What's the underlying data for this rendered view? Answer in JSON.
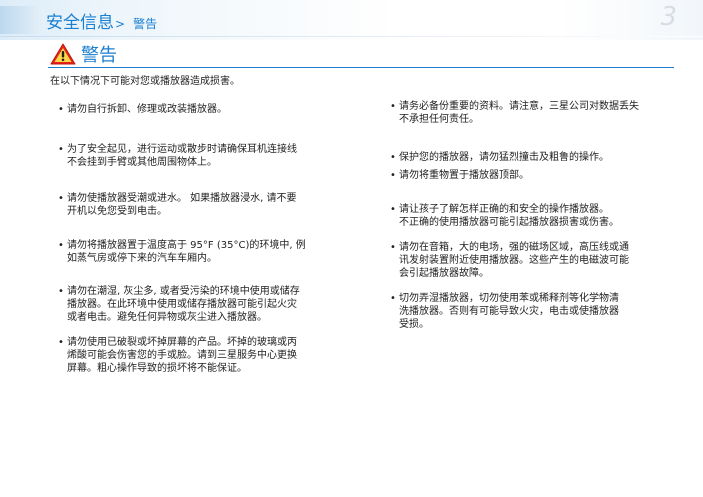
{
  "header": {
    "section": "安全信息",
    "separator": ">",
    "subsection": "警告",
    "page_number": "3"
  },
  "warning": {
    "title": "警告",
    "icon": "warning-triangle-icon",
    "icon_color": "#e8241a"
  },
  "intro": "在以下情况下可能对您或播放器造成损害。",
  "left_items": [
    {
      "lines": [
        "请勿自行拆卸、修理或改装播放器。"
      ]
    },
    {
      "lines": [
        "为了安全起见，进行运动或散步时请确保耳机连接线",
        "不会挂到手臂或其他周围物体上。"
      ]
    },
    {
      "lines": [
        "请勿使播放器受潮或进水。  如果播放器浸水, 请不要",
        "开机以免您受到电击。"
      ]
    },
    {
      "lines": [
        "请勿将播放器置于温度高于 95°F (35°C)的环境中, 例",
        "如蒸气房或停下来的汽车车厢内。"
      ]
    },
    {
      "lines": [
        "请勿在潮湿, 灰尘多, 或者受污染的环境中使用或储存",
        "播放器。在此环境中使用或储存播放器可能引起火灾",
        "或者电击。避免任何异物或灰尘进入播放器。"
      ]
    },
    {
      "lines": [
        "请勿使用已破裂或坏掉屏幕的产品。坏掉的玻璃或丙",
        "烯酸可能会伤害您的手或脸。请到三星服务中心更换",
        "屏幕。粗心操作导致的损坏将不能保证。"
      ]
    }
  ],
  "right_items": [
    {
      "lines": [
        "请务必备份重要的资料。请注意，三星公司对数据丢失",
        "不承担任何责任。"
      ]
    },
    {
      "lines": [
        "保护您的播放器，请勿猛烈撞击及粗鲁的操作。"
      ]
    },
    {
      "lines": [
        "请勿将重物置于播放器顶部。"
      ]
    },
    {
      "lines": [
        "请让孩子了解怎样正确的和安全的操作播放器。",
        "不正确的使用播放器可能引起播放器损害或伤害。"
      ]
    },
    {
      "lines": [
        "请勿在音箱，大的电场，强的磁场区域，高压线或通",
        "讯发射装置附近使用播放器。这些产生的电磁波可能",
        "会引起播放器故障。"
      ]
    },
    {
      "lines": [
        "切勿弄湿播放器，切勿使用苯或稀释剂等化学物清",
        "洗播放器。否则有可能导致火灾，电击或使播放器",
        "受损。"
      ]
    }
  ],
  "bullet": "•"
}
